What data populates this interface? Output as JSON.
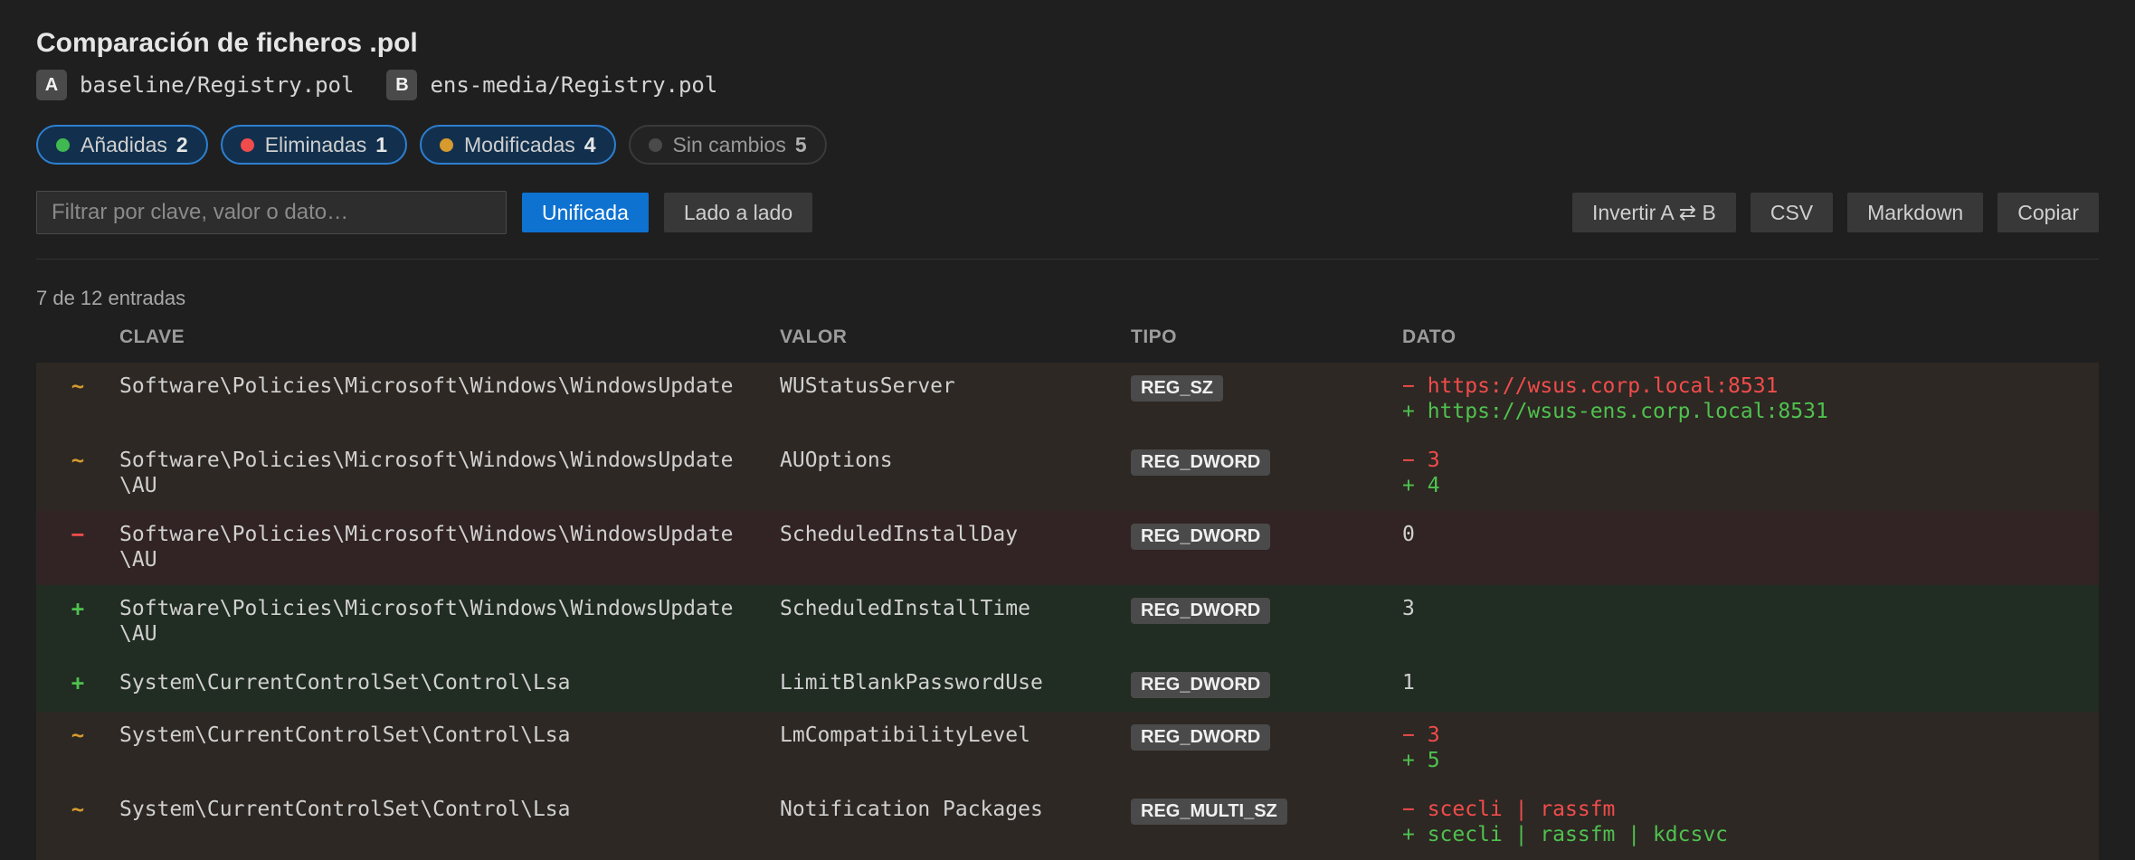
{
  "header": {
    "title": "Comparación de ficheros .pol",
    "file_a_label": "A",
    "file_a_path": "baseline/Registry.pol",
    "file_b_label": "B",
    "file_b_path": "ens-media/Registry.pol"
  },
  "chips": [
    {
      "label": "Añadidas",
      "count": "2",
      "color": "#3fb950",
      "active": true
    },
    {
      "label": "Eliminadas",
      "count": "1",
      "color": "#f14c4c",
      "active": true
    },
    {
      "label": "Modificadas",
      "count": "4",
      "color": "#d69a2e",
      "active": true
    },
    {
      "label": "Sin cambios",
      "count": "5",
      "color": "#4a4a4a",
      "active": false
    }
  ],
  "toolbar": {
    "filter_placeholder": "Filtrar por clave, valor o dato…",
    "view_unified": "Unificada",
    "view_side": "Lado a lado",
    "invert": "Invertir A ⇄ B",
    "csv": "CSV",
    "markdown": "Markdown",
    "copy": "Copiar"
  },
  "summary": "7 de 12 entradas",
  "columns": {
    "key": "CLAVE",
    "value": "VALOR",
    "type": "TIPO",
    "data": "DATO"
  },
  "rows": [
    {
      "status": "mod",
      "sign": "~",
      "key": "Software\\Policies\\Microsoft\\Windows\\WindowsUpdate",
      "value": "WUStatusServer",
      "type": "REG_SZ",
      "old": "− https://wsus.corp.local:8531",
      "new": "+ https://wsus-ens.corp.local:8531"
    },
    {
      "status": "mod",
      "sign": "~",
      "key": "Software\\Policies\\Microsoft\\Windows\\WindowsUpdate\\AU",
      "value": "AUOptions",
      "type": "REG_DWORD",
      "old": "− 3",
      "new": "+ 4"
    },
    {
      "status": "del",
      "sign": "−",
      "key": "Software\\Policies\\Microsoft\\Windows\\WindowsUpdate\\AU",
      "value": "ScheduledInstallDay",
      "type": "REG_DWORD",
      "data": "0"
    },
    {
      "status": "add",
      "sign": "+",
      "key": "Software\\Policies\\Microsoft\\Windows\\WindowsUpdate\\AU",
      "value": "ScheduledInstallTime",
      "type": "REG_DWORD",
      "data": "3"
    },
    {
      "status": "add",
      "sign": "+",
      "key": "System\\CurrentControlSet\\Control\\Lsa",
      "value": "LimitBlankPasswordUse",
      "type": "REG_DWORD",
      "data": "1"
    },
    {
      "status": "mod",
      "sign": "~",
      "key": "System\\CurrentControlSet\\Control\\Lsa",
      "value": "LmCompatibilityLevel",
      "type": "REG_DWORD",
      "old": "− 3",
      "new": "+ 5"
    },
    {
      "status": "mod",
      "sign": "~",
      "key": "System\\CurrentControlSet\\Control\\Lsa",
      "value": "Notification Packages",
      "type": "REG_MULTI_SZ",
      "old": "− scecli | rassfm",
      "new": "+ scecli | rassfm | kdcsvc"
    }
  ]
}
